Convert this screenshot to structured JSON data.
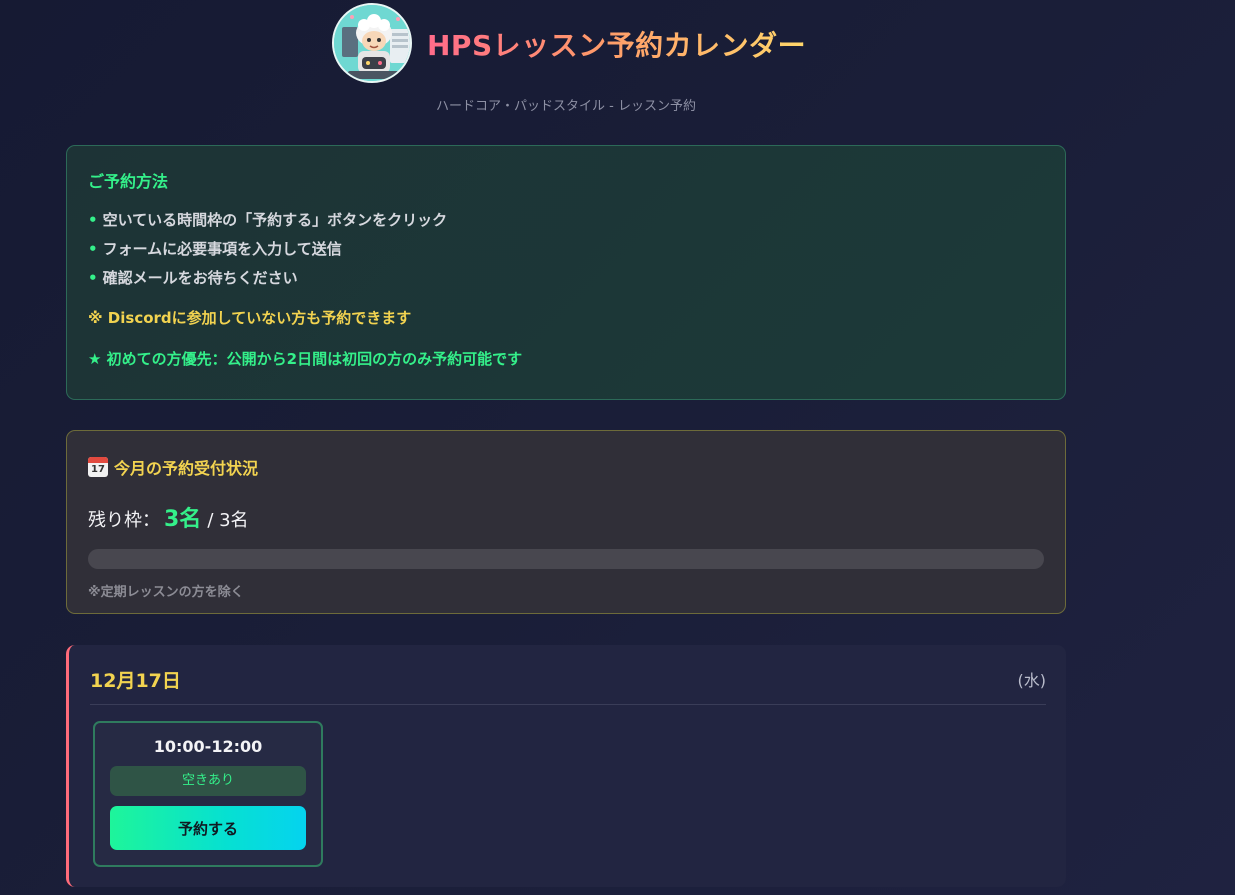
{
  "header": {
    "title": "HPSレッスン予約カレンダー",
    "subtitle": "ハードコア・パッドスタイル - レッスン予約"
  },
  "howto": {
    "title": "ご予約方法",
    "steps": [
      "空いている時間枠の「予約する」ボタンをクリック",
      "フォームに必要事項を入力して送信",
      "確認メールをお待ちください"
    ],
    "note_discord": "※ Discordに参加していない方も予約できます",
    "note_first": "★ 初めての方優先：公開から2日間は初回の方のみ予約可能です"
  },
  "status": {
    "title": "今月の予約受付状況",
    "calendar_icon_day": "17",
    "remaining_label": "残り枠：",
    "remaining_count": "3名",
    "remaining_total": "/ 3名",
    "progress_fraction": 0,
    "note": "※定期レッスンの方を除く"
  },
  "schedule": {
    "day": {
      "date": "12月17日",
      "weekday": "(水)",
      "slots": [
        {
          "time": "10:00-12:00",
          "status": "空きあり",
          "button_label": "予約する"
        }
      ]
    }
  },
  "colors": {
    "accent_green": "#34f08a",
    "accent_yellow": "#f2d350",
    "accent_pink": "#ff6b7a"
  }
}
